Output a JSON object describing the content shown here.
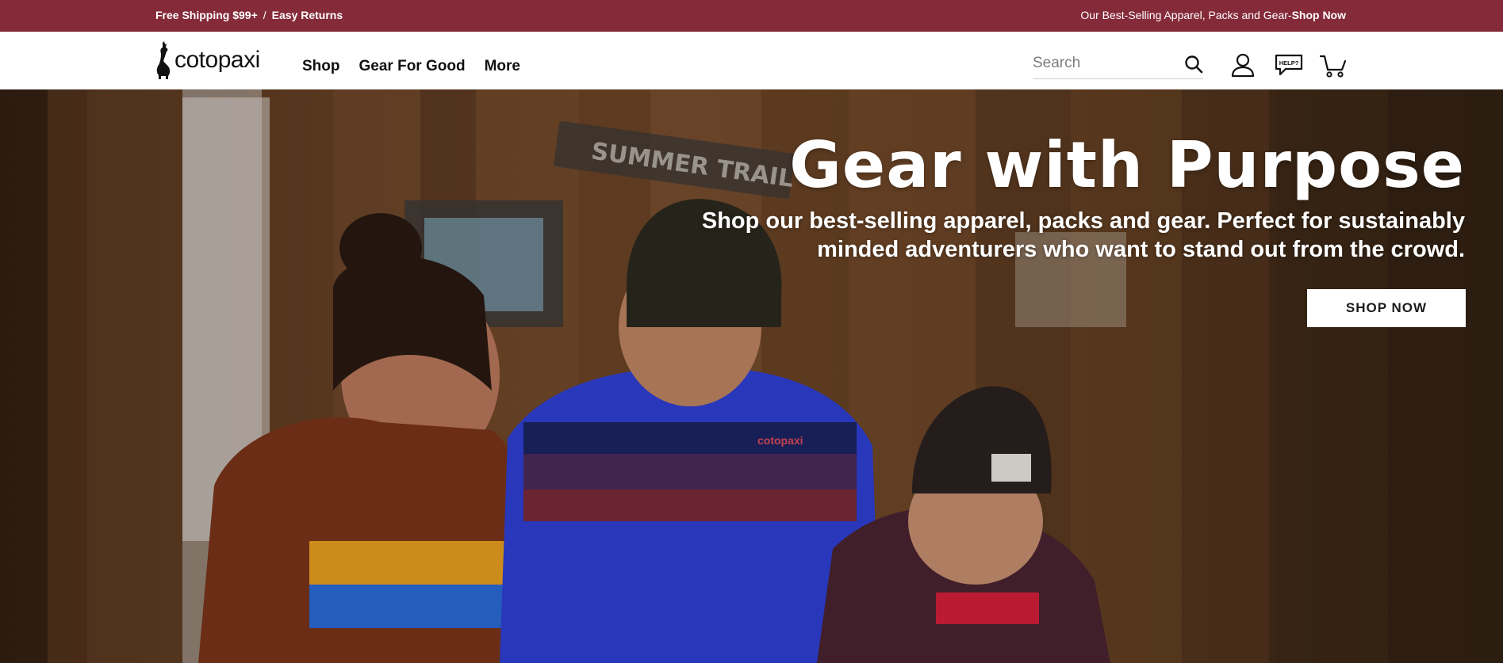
{
  "announcement": {
    "shipping": "Free Shipping $99+",
    "separator": "/",
    "returns": "Easy Returns",
    "promo_text": "Our Best-Selling Apparel, Packs and Gear-",
    "promo_link": "Shop Now"
  },
  "header": {
    "logo_text": "cotopaxi",
    "nav": [
      "Shop",
      "Gear For Good",
      "More"
    ],
    "search_placeholder": "Search",
    "help_badge": "HELP?",
    "icons": [
      "search-icon",
      "account-icon",
      "help-chat-icon",
      "cart-icon"
    ]
  },
  "hero": {
    "title": "Gear with Purpose",
    "subtitle": "Shop our best-selling apparel, packs and gear. Perfect for sustainably minded adventurers who want to stand out from the crowd.",
    "cta": "SHOP NOW",
    "sign_text": "SUMMER TRAIL",
    "jacket_brand": "cotopaxi"
  },
  "colors": {
    "announcement_bg": "#852a38",
    "header_bg": "#ffffff",
    "cta_bg": "#ffffff"
  }
}
